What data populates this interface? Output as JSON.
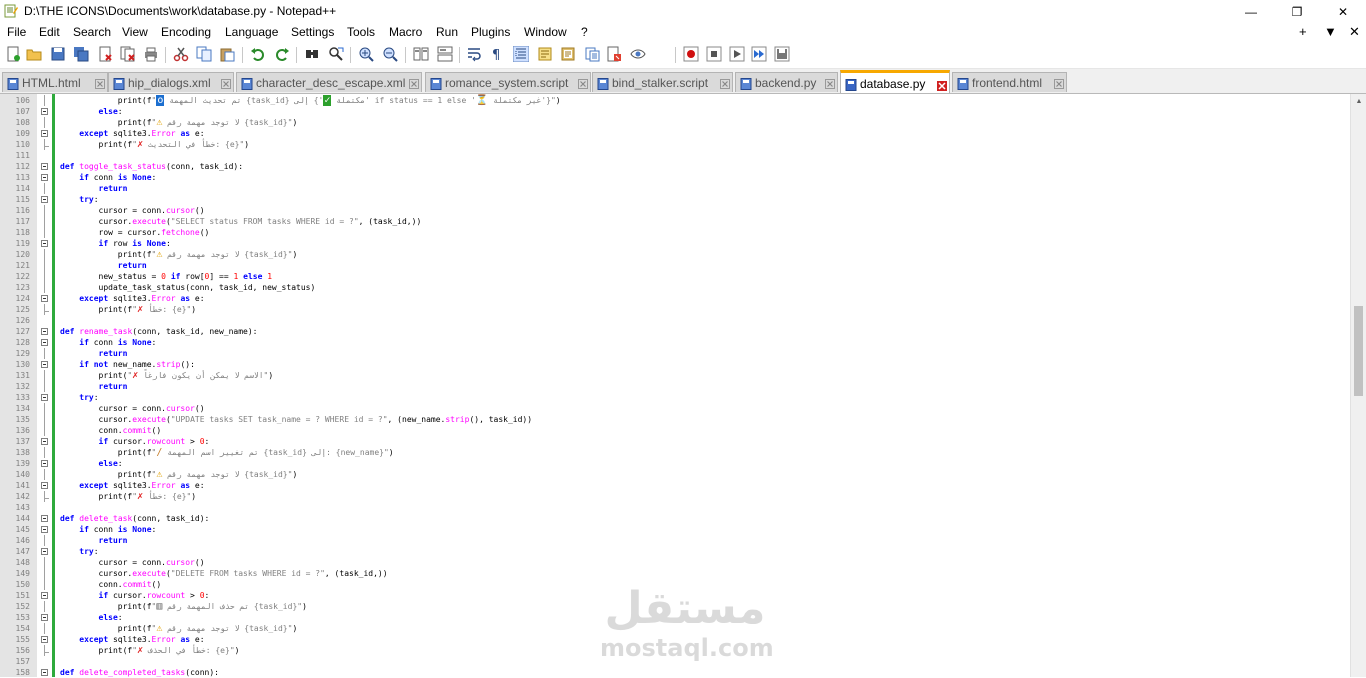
{
  "window": {
    "title": "D:\\THE ICONS\\Documents\\work\\database.py - Notepad++",
    "minimize_glyph": "—",
    "maximize_glyph": "❐",
    "close_glyph": "✕"
  },
  "menu": {
    "items": [
      "File",
      "Edit",
      "Search",
      "View",
      "Encoding",
      "Language",
      "Settings",
      "Tools",
      "Macro",
      "Run",
      "Plugins",
      "Window",
      "?"
    ],
    "right_plus": "+",
    "right_dropdown": "▼",
    "right_close": "✕"
  },
  "toolbar": {
    "icons": [
      "new-file-icon",
      "open-file-icon",
      "save-icon",
      "save-all-icon",
      "close-icon",
      "close-all-icon",
      "print-icon",
      "cut-icon",
      "copy-icon",
      "paste-icon",
      "undo-icon",
      "redo-icon",
      "find-icon",
      "replace-icon",
      "zoom-in-icon",
      "zoom-out-icon",
      "sync-vertical-icon",
      "sync-horizontal-icon",
      "word-wrap-icon",
      "show-all-chars-icon",
      "indent-guide-icon",
      "language-icon",
      "doc-map-icon",
      "function-list-icon",
      "folder-as-workspace-icon",
      "monitoring-icon",
      "record-macro-icon",
      "stop-record-icon",
      "play-macro-icon",
      "run-macro-multiple-icon",
      "save-macro-icon"
    ]
  },
  "tabs": [
    {
      "label": "HTML.html",
      "active": false
    },
    {
      "label": "hip_dialogs.xml",
      "active": false
    },
    {
      "label": "character_desc_escape.xml",
      "active": false
    },
    {
      "label": "romance_system.script",
      "active": false
    },
    {
      "label": "bind_stalker.script",
      "active": false
    },
    {
      "label": "backend.py",
      "active": false
    },
    {
      "label": "database.py",
      "active": true
    },
    {
      "label": "frontend.html",
      "active": false
    }
  ],
  "editor": {
    "lines": [
      {
        "n": "106",
        "text": "            print(f\"ℹ تم تحديث المهمة {task_id} إلى {'✅ مكتملة' if status == 1 else '⏳ غير مكتملة'}\")"
      },
      {
        "n": "107",
        "text": "        else:"
      },
      {
        "n": "108",
        "text": "            print(f\"⚠ لا توجد مهمة رقم {task_id}\")"
      },
      {
        "n": "109",
        "text": "    except sqlite3.Error as e:"
      },
      {
        "n": "110",
        "text": "        print(f\"❌ خطأ في التحديث: {e}\")"
      },
      {
        "n": "111",
        "text": ""
      },
      {
        "n": "112",
        "text": "def toggle_task_status(conn, task_id):"
      },
      {
        "n": "113",
        "text": "    if conn is None:"
      },
      {
        "n": "114",
        "text": "        return"
      },
      {
        "n": "115",
        "text": "    try:"
      },
      {
        "n": "116",
        "text": "        cursor = conn.cursor()"
      },
      {
        "n": "117",
        "text": "        cursor.execute(\"SELECT status FROM tasks WHERE id = ?\", (task_id,))"
      },
      {
        "n": "118",
        "text": "        row = cursor.fetchone()"
      },
      {
        "n": "119",
        "text": "        if row is None:"
      },
      {
        "n": "120",
        "text": "            print(f\"⚠ لا توجد مهمة رقم {task_id}\")"
      },
      {
        "n": "121",
        "text": "            return"
      },
      {
        "n": "122",
        "text": "        new_status = 0 if row[0] == 1 else 1"
      },
      {
        "n": "123",
        "text": "        update_task_status(conn, task_id, new_status)"
      },
      {
        "n": "124",
        "text": "    except sqlite3.Error as e:"
      },
      {
        "n": "125",
        "text": "        print(f\"❌ خطأ: {e}\")"
      },
      {
        "n": "126",
        "text": ""
      },
      {
        "n": "127",
        "text": "def rename_task(conn, task_id, new_name):"
      },
      {
        "n": "128",
        "text": "    if conn is None:"
      },
      {
        "n": "129",
        "text": "        return"
      },
      {
        "n": "130",
        "text": "    if not new_name.strip():"
      },
      {
        "n": "131",
        "text": "        print(\"❌ الاسم لا يمكن أن يكون فارغاً\")"
      },
      {
        "n": "132",
        "text": "        return"
      },
      {
        "n": "133",
        "text": "    try:"
      },
      {
        "n": "134",
        "text": "        cursor = conn.cursor()"
      },
      {
        "n": "135",
        "text": "        cursor.execute(\"UPDATE tasks SET task_name = ? WHERE id = ?\", (new_name.strip(), task_id))"
      },
      {
        "n": "136",
        "text": "        conn.commit()"
      },
      {
        "n": "137",
        "text": "        if cursor.rowcount > 0:"
      },
      {
        "n": "138",
        "text": "            print(f\"✏ تم تغيير اسم المهمة {task_id} إلى: {new_name}\")"
      },
      {
        "n": "139",
        "text": "        else:"
      },
      {
        "n": "140",
        "text": "            print(f\"⚠ لا توجد مهمة رقم {task_id}\")"
      },
      {
        "n": "141",
        "text": "    except sqlite3.Error as e:"
      },
      {
        "n": "142",
        "text": "        print(f\"❌ خطأ: {e}\")"
      },
      {
        "n": "143",
        "text": ""
      },
      {
        "n": "144",
        "text": "def delete_task(conn, task_id):"
      },
      {
        "n": "145",
        "text": "    if conn is None:"
      },
      {
        "n": "146",
        "text": "        return"
      },
      {
        "n": "147",
        "text": "    try:"
      },
      {
        "n": "148",
        "text": "        cursor = conn.cursor()"
      },
      {
        "n": "149",
        "text": "        cursor.execute(\"DELETE FROM tasks WHERE id = ?\", (task_id,))"
      },
      {
        "n": "150",
        "text": "        conn.commit()"
      },
      {
        "n": "151",
        "text": "        if cursor.rowcount > 0:"
      },
      {
        "n": "152",
        "text": "            print(f\"🗑 تم حذف المهمة رقم {task_id}\")"
      },
      {
        "n": "153",
        "text": "        else:"
      },
      {
        "n": "154",
        "text": "            print(f\"⚠ لا توجد مهمة رقم {task_id}\")"
      },
      {
        "n": "155",
        "text": "    except sqlite3.Error as e:"
      },
      {
        "n": "156",
        "text": "        print(f\"❌ خطأ في الحذف: {e}\")"
      },
      {
        "n": "157",
        "text": ""
      },
      {
        "n": "158",
        "text": "def delete_completed_tasks(conn):"
      }
    ]
  },
  "watermark": {
    "arabic": "مستقل",
    "latin": "mostaql.com"
  },
  "colors": {
    "accent_tab": "#f7a800",
    "change_bar": "#2eaa3c",
    "keyword": "#0000ff",
    "function": "#ff00ff",
    "class": "#000080",
    "string": "#808080",
    "number": "#ff0000"
  }
}
